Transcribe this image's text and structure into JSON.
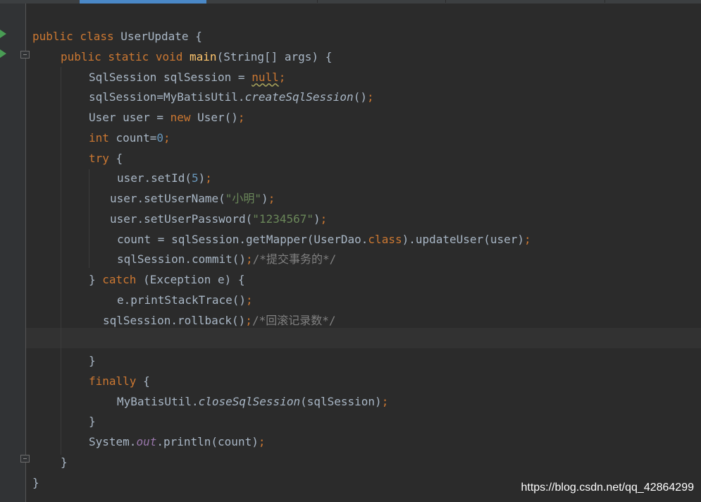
{
  "editor": {
    "lines": [
      {
        "indent": 46,
        "parts": [
          {
            "t": "public class ",
            "c": "kw"
          },
          {
            "t": "UserUpdate {",
            "c": ""
          }
        ]
      },
      {
        "indent": 86,
        "parts": [
          {
            "t": "public static void ",
            "c": "kw"
          },
          {
            "t": "main",
            "c": "fn"
          },
          {
            "t": "(String[] args) {",
            "c": ""
          }
        ]
      },
      {
        "indent": 126,
        "parts": [
          {
            "t": "SqlSession sqlSession = ",
            "c": ""
          },
          {
            "t": "null",
            "c": "warn-null"
          },
          {
            "t": ";",
            "c": "semi"
          }
        ]
      },
      {
        "indent": 126,
        "parts": [
          {
            "t": "sqlSession=MyBatisUtil.",
            "c": ""
          },
          {
            "t": "createSqlSession",
            "c": "it"
          },
          {
            "t": "()",
            "c": ""
          },
          {
            "t": ";",
            "c": "semi"
          }
        ]
      },
      {
        "indent": 126,
        "parts": [
          {
            "t": "User user = ",
            "c": ""
          },
          {
            "t": "new ",
            "c": "kw"
          },
          {
            "t": "User()",
            "c": ""
          },
          {
            "t": ";",
            "c": "semi"
          }
        ]
      },
      {
        "indent": 126,
        "parts": [
          {
            "t": "int ",
            "c": "kw"
          },
          {
            "t": "count=",
            "c": ""
          },
          {
            "t": "0",
            "c": "num"
          },
          {
            "t": ";",
            "c": "semi"
          }
        ]
      },
      {
        "indent": 126,
        "parts": [
          {
            "t": "try ",
            "c": "kw"
          },
          {
            "t": "{",
            "c": ""
          }
        ]
      },
      {
        "indent": 166,
        "parts": [
          {
            "t": "user.setId(",
            "c": ""
          },
          {
            "t": "5",
            "c": "num"
          },
          {
            "t": ")",
            "c": ""
          },
          {
            "t": ";",
            "c": "semi"
          }
        ]
      },
      {
        "indent": 156,
        "parts": [
          {
            "t": "user.setUserName(",
            "c": ""
          },
          {
            "t": "\"小明\"",
            "c": "str"
          },
          {
            "t": ")",
            "c": ""
          },
          {
            "t": ";",
            "c": "semi"
          }
        ]
      },
      {
        "indent": 156,
        "parts": [
          {
            "t": "user.setUserPassword(",
            "c": ""
          },
          {
            "t": "\"1234567\"",
            "c": "str"
          },
          {
            "t": ")",
            "c": ""
          },
          {
            "t": ";",
            "c": "semi"
          }
        ]
      },
      {
        "indent": 166,
        "parts": [
          {
            "t": "count = sqlSession.getMapper(UserDao.",
            "c": ""
          },
          {
            "t": "class",
            "c": "kw"
          },
          {
            "t": ").updateUser(user)",
            "c": ""
          },
          {
            "t": ";",
            "c": "semi"
          }
        ]
      },
      {
        "indent": 166,
        "parts": [
          {
            "t": "sqlSession.commit()",
            "c": ""
          },
          {
            "t": ";",
            "c": "semi"
          },
          {
            "t": "/*提交事务的*/",
            "c": "cmt"
          }
        ]
      },
      {
        "indent": 126,
        "parts": [
          {
            "t": "} ",
            "c": ""
          },
          {
            "t": "catch ",
            "c": "kw"
          },
          {
            "t": "(Exception e) {",
            "c": ""
          }
        ]
      },
      {
        "indent": 166,
        "parts": [
          {
            "t": "e.printStackTrace()",
            "c": ""
          },
          {
            "t": ";",
            "c": "semi"
          }
        ]
      },
      {
        "indent": 146,
        "parts": [
          {
            "t": "sqlSession.rollback()",
            "c": ""
          },
          {
            "t": ";",
            "c": "semi"
          },
          {
            "t": "/*回滚记录数*/",
            "c": "cmt"
          }
        ]
      },
      {
        "indent": 146,
        "parts": []
      },
      {
        "indent": 126,
        "parts": [
          {
            "t": "}",
            "c": ""
          }
        ]
      },
      {
        "indent": 126,
        "parts": [
          {
            "t": "finally ",
            "c": "kw"
          },
          {
            "t": "{",
            "c": ""
          }
        ]
      },
      {
        "indent": 166,
        "parts": [
          {
            "t": "MyBatisUtil.",
            "c": ""
          },
          {
            "t": "closeSqlSession",
            "c": "it"
          },
          {
            "t": "(sqlSession)",
            "c": ""
          },
          {
            "t": ";",
            "c": "semi"
          }
        ]
      },
      {
        "indent": 126,
        "parts": [
          {
            "t": "}",
            "c": ""
          }
        ]
      },
      {
        "indent": 126,
        "parts": [
          {
            "t": "System.",
            "c": ""
          },
          {
            "t": "out",
            "c": "static-field"
          },
          {
            "t": ".println(count)",
            "c": ""
          },
          {
            "t": ";",
            "c": "semi"
          }
        ]
      },
      {
        "indent": 86,
        "parts": [
          {
            "t": "}",
            "c": ""
          }
        ]
      },
      {
        "indent": 46,
        "parts": [
          {
            "t": "}",
            "c": ""
          }
        ]
      }
    ]
  },
  "watermark": {
    "text": "https://blog.csdn.net/qq_42864299"
  },
  "colors": {
    "background": "#2b2b2b",
    "gutter": "#313335",
    "keyword": "#cc7832",
    "method_decl": "#ffc66d",
    "number": "#6897bb",
    "string": "#6a8759",
    "static_field": "#9876aa",
    "comment": "#808080",
    "default_text": "#a9b7c6",
    "active_tab": "#4a88c7",
    "run_icon": "#499c54"
  },
  "icons": [
    "run-gutter-icon",
    "fold-icon"
  ]
}
